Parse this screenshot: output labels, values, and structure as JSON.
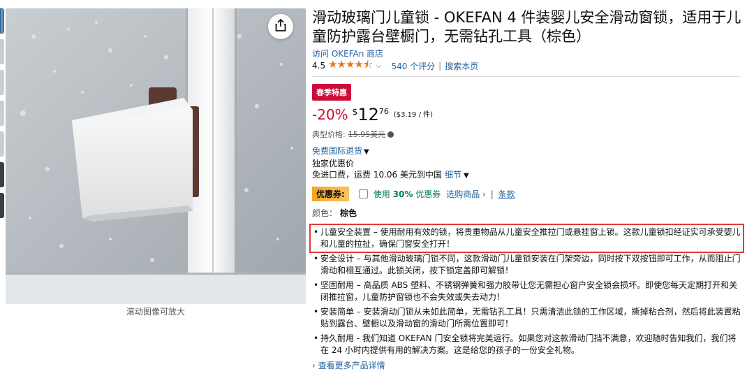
{
  "image_caption": "滚动图像可放大",
  "product": {
    "title": "滑动玻璃门儿童锁 - OKEFAN 4 件装婴儿安全滑动窗锁，适用于儿童防护露台壁橱门，无需钻孔工具（棕色）",
    "store_link": "访问 OKEFAn 商店",
    "rating": "4.5",
    "stars": "★★★★⯪",
    "rating_count": "540 个评分",
    "search_page": "搜索本页",
    "deal_badge": "春季特惠",
    "discount": "-20%",
    "currency": "$",
    "price_whole": "12",
    "price_fraction": "76",
    "unit_price": "($3.19 / 件)",
    "typical_label": "典型价格:",
    "typical_price": "15.95美元",
    "returns": "免费国际退货",
    "exclusive": "独家优惠价",
    "shipping": "免进口费，运费 10.06 美元到中国",
    "shipping_details": "细节",
    "coupon_label": "优惠券:",
    "coupon_text_pre": "使用",
    "coupon_percent": "30%",
    "coupon_text_post": "优惠券",
    "coupon_select": "选购商品 ›",
    "coupon_sep": "|",
    "coupon_terms": "条款",
    "color_label": "颜色：",
    "color_value": "棕色",
    "more_details": "› 查看更多产品详情"
  },
  "bullets": [
    "儿童安全装置 – 使用耐用有效的锁，将贵重物品从儿童安全推拉门或悬挂窗上锁。这款儿童锁扣经证实可承受婴儿和儿童的拉扯，确保门窗安全打开！",
    "安全设计 – 与其他滑动玻璃门锁不同，这款滑动门儿童锁安装在门架旁边，同时按下双按钮即可工作，从而阻止门滑动和相互通过。此锁关闭，按下锁定盖即可解锁！",
    "坚固耐用 – 高品质 ABS 塑料、不锈钢弹簧和强力胶带让您无需担心窗户安全锁会损坏。即使您每天定期打开和关闭推拉窗，儿童防护窗锁也不会失效或失去动力！",
    "安装简单 – 安装滑动门锁从未如此简单，无需钻孔工具！只需清洁此锁的工作区域，撕掉粘合剂，然后将此装置粘贴到露台、壁橱以及滑动窗的滑动门所需位置即可！",
    "持久耐用 - 我们知道 OKEFAN 门安全锁将完美运行。如果您对这款滑动门挡不满意，欢迎随时告知我们，我们将在 24 小时内提供有用的解决方案。这是给您的孩子的一份安全礼物。"
  ],
  "icons": {
    "share": "share-icon",
    "info": "info-icon",
    "chevron": "chevron-down-icon"
  },
  "colors": {
    "deal_red": "#cc0c39",
    "link_blue": "#2162a1",
    "star_orange": "#de7921",
    "coupon_green": "#067d62",
    "highlight_red": "#e53935"
  }
}
